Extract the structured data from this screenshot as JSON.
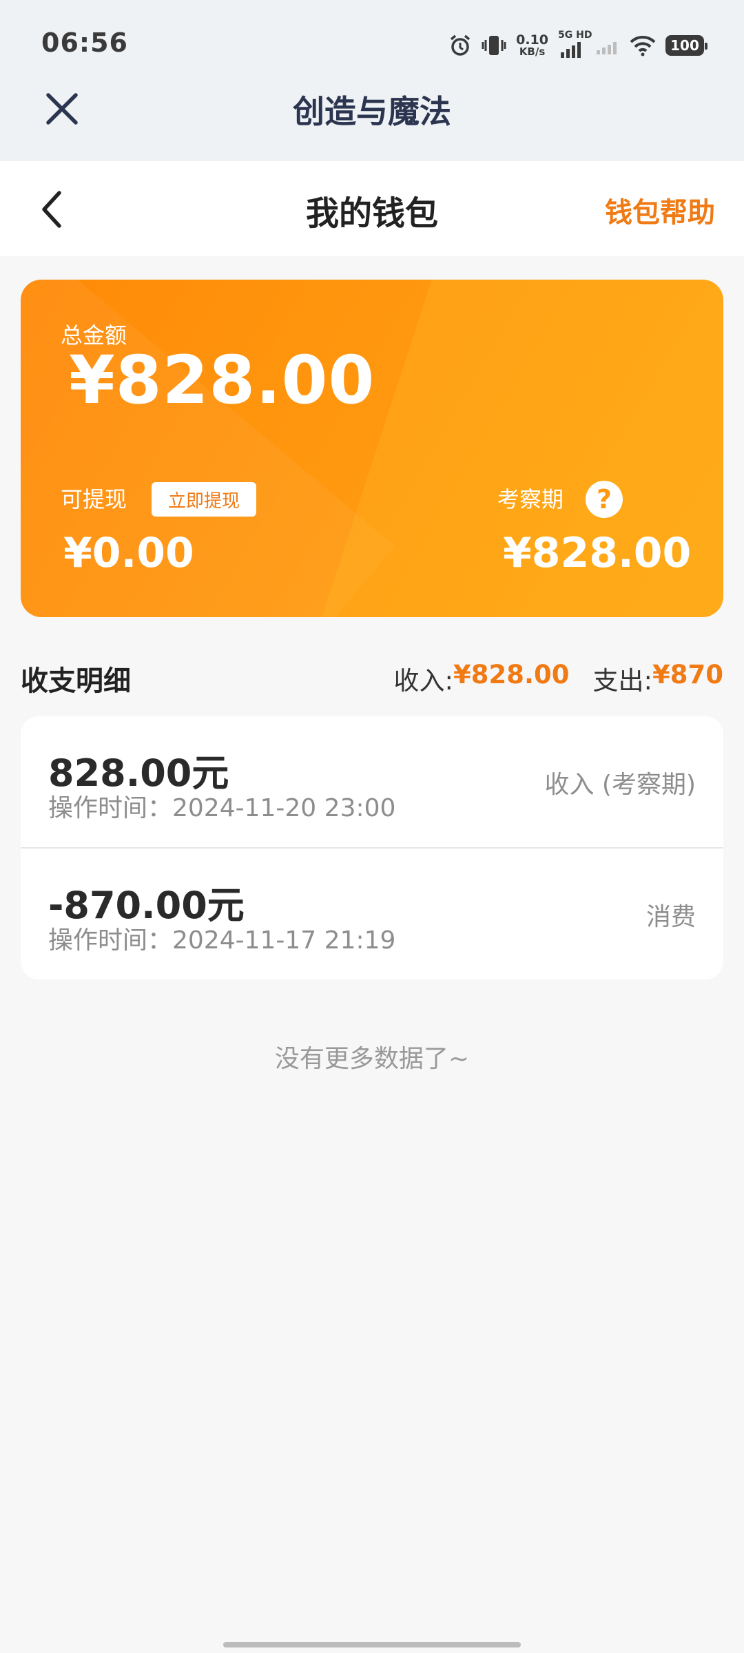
{
  "status_bar": {
    "time": "06:56",
    "net_speed_value": "0.10",
    "net_speed_unit": "KB/s",
    "signal_label": "5G HD",
    "battery": "100"
  },
  "webview": {
    "title": "创造与魔法"
  },
  "nav": {
    "title": "我的钱包",
    "help": "钱包帮助"
  },
  "wallet": {
    "total_label": "总金额",
    "total_amount": "¥828.00",
    "withdrawable_label": "可提现",
    "withdraw_button": "立即提现",
    "withdrawable_amount": "¥0.00",
    "probation_label": "考察期",
    "probation_amount": "¥828.00"
  },
  "details": {
    "title": "收支明细",
    "income_label": "收入:",
    "income_amount": "¥828.00",
    "expense_label": "支出:",
    "expense_amount": "¥870",
    "records": [
      {
        "amount": "828.00元",
        "time": "操作时间：2024-11-20 23:00",
        "type": "收入 (考察期)"
      },
      {
        "amount": "-870.00元",
        "time": "操作时间：2024-11-17 21:19",
        "type": "消费"
      }
    ],
    "no_more": "没有更多数据了~"
  },
  "colors": {
    "accent": "#f07a14",
    "card_start": "#ff8a08",
    "card_end": "#ffa515"
  }
}
